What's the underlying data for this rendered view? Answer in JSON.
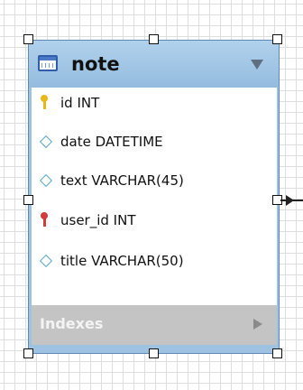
{
  "table": {
    "name": "note",
    "icon": "table-icon",
    "columns": [
      {
        "label": "id INT",
        "icon": "primary-key-icon"
      },
      {
        "label": "date DATETIME",
        "icon": "column-diamond-icon"
      },
      {
        "label": "text VARCHAR(45)",
        "icon": "column-diamond-icon"
      },
      {
        "label": "user_id INT",
        "icon": "foreign-key-icon"
      },
      {
        "label": "title VARCHAR(50)",
        "icon": "column-diamond-icon"
      }
    ],
    "indexes_label": "Indexes"
  },
  "colors": {
    "header": "#9ec3e2",
    "border": "#5d89b4",
    "primary_key": "#e8b818",
    "foreign_key": "#d23c3c",
    "column_marker": "#5aa8c8",
    "indexes_bar": "#c4c4c4"
  }
}
